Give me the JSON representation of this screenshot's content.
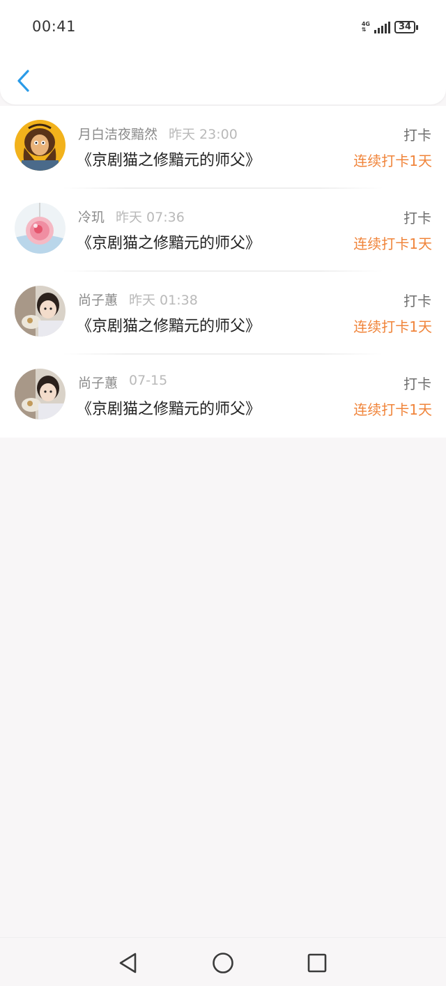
{
  "status_bar": {
    "time": "00:41",
    "network": "4G",
    "battery": "34"
  },
  "header": {
    "back_icon": "chevron-left-icon",
    "accent_color": "#2a9be8"
  },
  "entries": [
    {
      "user": "月白洁夜黯然",
      "time": "昨天 23:00",
      "book": "《京剧猫之修黯元的师父》",
      "action": "打卡",
      "streak": "连续打卡1天",
      "avatar": "cartoon-character-avatar"
    },
    {
      "user": "冷玑",
      "time": "昨天 07:36",
      "book": "《京剧猫之修黯元的师父》",
      "action": "打卡",
      "streak": "连续打卡1天",
      "avatar": "pink-pendant-avatar"
    },
    {
      "user": "尚子蕙",
      "time": "昨天 01:38",
      "book": "《京剧猫之修黯元的师父》",
      "action": "打卡",
      "streak": "连续打卡1天",
      "avatar": "child-photo-avatar"
    },
    {
      "user": "尚子蕙",
      "time": "07-15",
      "book": "《京剧猫之修黯元的师父》",
      "action": "打卡",
      "streak": "连续打卡1天",
      "avatar": "child-photo-avatar"
    }
  ],
  "colors": {
    "streak": "#f0843a",
    "page_background": "#f8f6f7"
  },
  "nav": {
    "back_icon": "triangle-back-icon",
    "home_icon": "circle-home-icon",
    "recents_icon": "square-recents-icon"
  }
}
